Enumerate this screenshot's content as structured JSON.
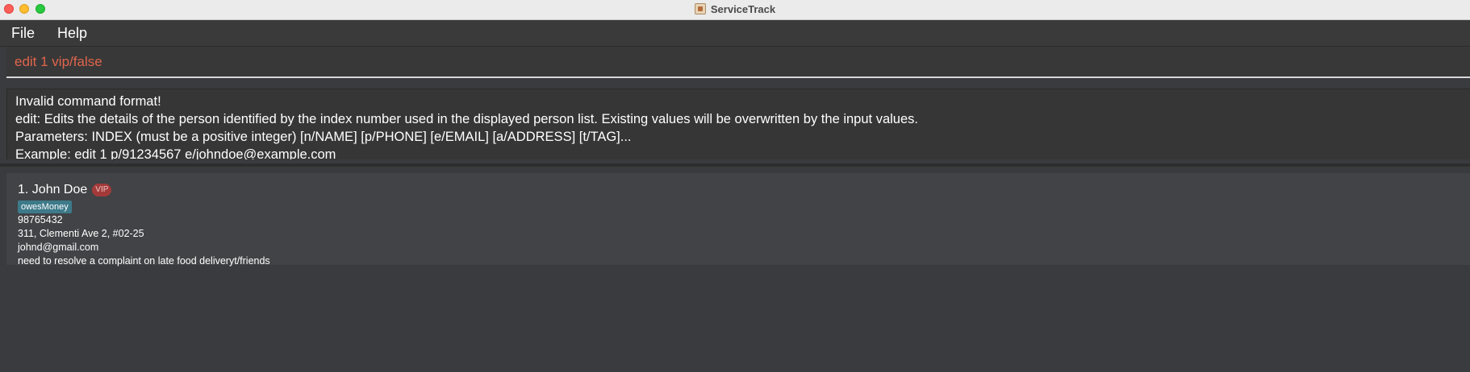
{
  "window": {
    "title": "ServiceTrack"
  },
  "menu": {
    "items": [
      {
        "label": "File"
      },
      {
        "label": "Help"
      }
    ]
  },
  "command_box": {
    "value": "edit 1 vip/false",
    "text_color": "#e0654c"
  },
  "result_display": {
    "lines": [
      "Invalid command format!",
      "edit: Edits the details of the person identified by the index number used in the displayed person list. Existing values will be overwritten by the input values.",
      "Parameters: INDEX (must be a positive integer) [n/NAME] [p/PHONE] [e/EMAIL] [a/ADDRESS] [t/TAG]...",
      "Example: edit 1 p/91234567 e/johndoe@example.com"
    ]
  },
  "person_list": {
    "persons": [
      {
        "index_name": "1. John Doe",
        "vip_label": "VIP",
        "tags": [
          "owesMoney"
        ],
        "phone": "98765432",
        "address": "311, Clementi Ave 2, #02-25",
        "email": "johnd@gmail.com",
        "remark": "need to resolve a complaint on late food deliveryt/friends"
      }
    ]
  },
  "colors": {
    "background": "#3a3b3e",
    "card": "#414346",
    "vip_badge": "#a33a3a",
    "tag": "#3d7a8a",
    "close": "#fe5f57",
    "minimize": "#febc2e",
    "maximize": "#28c840"
  },
  "icons": {
    "app": "app-icon"
  }
}
